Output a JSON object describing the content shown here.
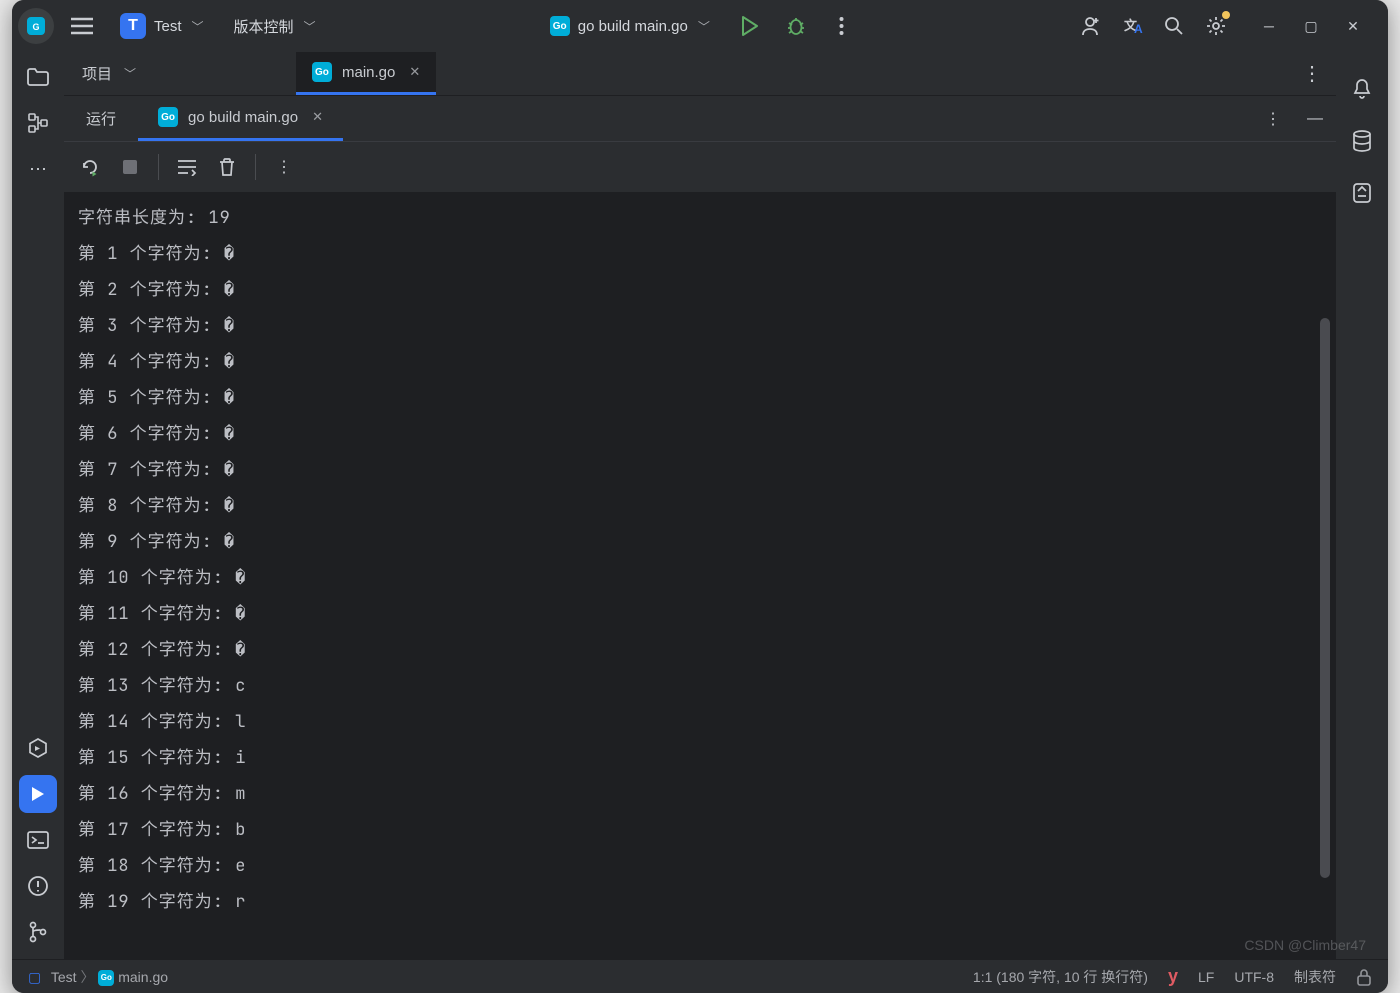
{
  "toolbar": {
    "project_name": "Test",
    "vcs_label": "版本控制",
    "run_target": "go build main.go"
  },
  "editor": {
    "project_label": "项目",
    "open_file": "main.go"
  },
  "run_panel": {
    "run_tab_label": "运行",
    "config_label": "go build main.go"
  },
  "console_lines": [
    "字符串长度为: 19",
    "第 1 个字符为: �",
    "第 2 个字符为: �",
    "第 3 个字符为: �",
    "第 4 个字符为: �",
    "第 5 个字符为: �",
    "第 6 个字符为: �",
    "第 7 个字符为: �",
    "第 8 个字符为: �",
    "第 9 个字符为: �",
    "第 10 个字符为: �",
    "第 11 个字符为: �",
    "第 12 个字符为: �",
    "第 13 个字符为: c",
    "第 14 个字符为: l",
    "第 15 个字符为: i",
    "第 16 个字符为: m",
    "第 17 个字符为: b",
    "第 18 个字符为: e",
    "第 19 个字符为: r"
  ],
  "status": {
    "project": "Test",
    "file": "main.go",
    "cursor": "1:1 (180 字符, 10 行 换行符)",
    "line_sep": "LF",
    "encoding": "UTF-8",
    "indent": "制表符"
  },
  "watermark": "CSDN @Climber47"
}
